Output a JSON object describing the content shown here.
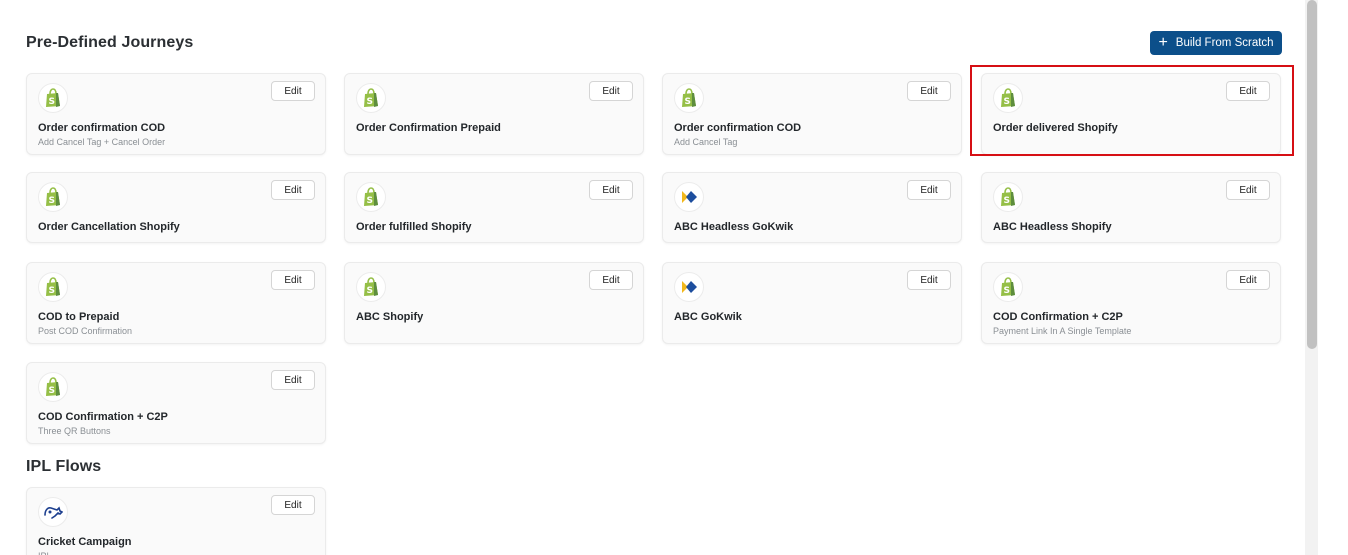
{
  "sections": {
    "predefined_title": "Pre-Defined Journeys",
    "ipl_title": "IPL Flows"
  },
  "build_button": {
    "icon": "plus-icon",
    "label": "Build From Scratch"
  },
  "colors": {
    "primary": "#0c4f8a",
    "highlight": "#d60f14",
    "shopify_green": "#95bf47",
    "gokwik_blue": "#1d4e9e",
    "gokwik_yellow": "#f2b81b"
  },
  "edit_label": "Edit",
  "cards": [
    {
      "title": "Order confirmation COD",
      "subtitle": "Add Cancel Tag + Cancel Order",
      "icon": "shopify-icon"
    },
    {
      "title": "Order Confirmation Prepaid",
      "subtitle": "",
      "icon": "shopify-icon"
    },
    {
      "title": "Order confirmation COD",
      "subtitle": "Add Cancel Tag",
      "icon": "shopify-icon"
    },
    {
      "title": "Order delivered Shopify",
      "subtitle": "",
      "icon": "shopify-icon"
    },
    {
      "title": "Order Cancellation Shopify",
      "subtitle": "",
      "icon": "shopify-icon"
    },
    {
      "title": "Order fulfilled Shopify",
      "subtitle": "",
      "icon": "shopify-icon"
    },
    {
      "title": "ABC Headless GoKwik",
      "subtitle": "",
      "icon": "gokwik-icon"
    },
    {
      "title": "ABC Headless Shopify",
      "subtitle": "",
      "icon": "shopify-icon"
    },
    {
      "title": "COD to Prepaid",
      "subtitle": "Post COD Confirmation",
      "icon": "shopify-icon"
    },
    {
      "title": "ABC Shopify",
      "subtitle": "",
      "icon": "shopify-icon"
    },
    {
      "title": "ABC GoKwik",
      "subtitle": "",
      "icon": "gokwik-icon"
    },
    {
      "title": "COD Confirmation + C2P",
      "subtitle": "Payment Link In A Single Template",
      "icon": "shopify-icon"
    },
    {
      "title": "COD Confirmation + C2P",
      "subtitle": "Three QR Buttons",
      "icon": "shopify-icon"
    }
  ],
  "ipl_cards": [
    {
      "title": "Cricket Campaign",
      "subtitle": "IPL",
      "icon": "ipl-icon"
    }
  ]
}
